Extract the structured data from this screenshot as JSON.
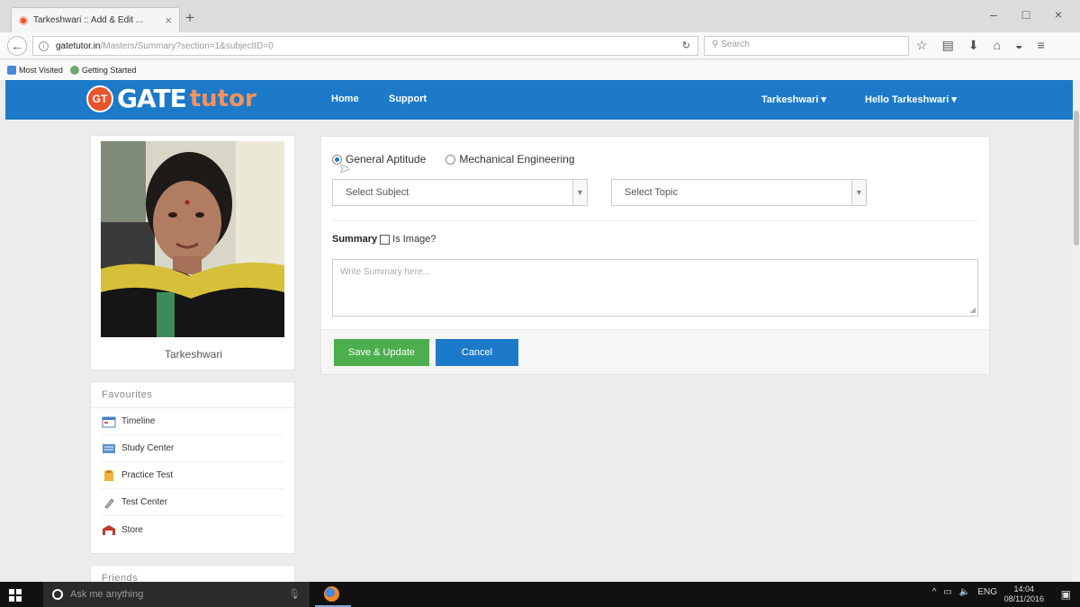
{
  "browser": {
    "tab_title": "Tarkeshwari :: Add & Edit ...",
    "tab_close": "×",
    "new_tab": "+",
    "window_controls": [
      "–",
      "□",
      "×"
    ],
    "url_domain": "gatetutor.in",
    "url_path": "/Masters/Summary?section=1&subjectID=0",
    "search_placeholder": "Search",
    "bookmarks": [
      "Most Visited",
      "Getting Started"
    ]
  },
  "site": {
    "logo_badge": "GT",
    "logo_gate": "GATE",
    "logo_tutor": "tutor",
    "nav": {
      "home": "Home",
      "support": "Support"
    },
    "user_menu": "Tarkeshwari ▾",
    "hello_menu": "Hello Tarkeshwari ▾",
    "accent_color": "#1c7ac9"
  },
  "profile": {
    "name": "Tarkeshwari"
  },
  "favourites": {
    "title": "Favourites",
    "items": [
      {
        "label": "Timeline",
        "icon": "timeline-icon"
      },
      {
        "label": "Study Center",
        "icon": "study-center-icon"
      },
      {
        "label": "Practice Test",
        "icon": "practice-test-icon"
      },
      {
        "label": "Test Center",
        "icon": "test-center-icon"
      },
      {
        "label": "Store",
        "icon": "store-icon"
      }
    ]
  },
  "friends": {
    "title": "Friends"
  },
  "form": {
    "radio_options": [
      {
        "label": "General Aptitude",
        "checked": true
      },
      {
        "label": "Mechanical Engineering",
        "checked": false
      }
    ],
    "subject_select": "Select Subject",
    "topic_select": "Select Topic",
    "summary_label": "Summary",
    "is_image_label": "Is Image?",
    "summary_placeholder": "Write Summary here...",
    "save_button": "Save & Update",
    "cancel_button": "Cancel"
  },
  "taskbar": {
    "search_placeholder": "Ask me anything",
    "language": "ENG",
    "time": "14:04",
    "date": "08/11/2016"
  }
}
